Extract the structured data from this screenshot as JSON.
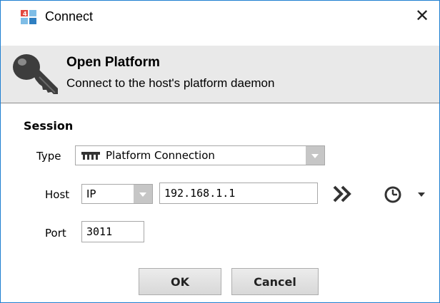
{
  "window": {
    "title": "Connect",
    "close_glyph": "✕"
  },
  "header": {
    "title": "Open Platform",
    "subtitle": "Connect to the host's platform daemon",
    "icon": "key-icon"
  },
  "session": {
    "section_label": "Session",
    "type": {
      "label": "Type",
      "value": "Platform Connection",
      "icon": "platform-connection-icon"
    },
    "host": {
      "label": "Host",
      "mode": "IP",
      "address": "192.168.1.1"
    },
    "port": {
      "label": "Port",
      "value": "3011"
    }
  },
  "actions": {
    "ok_label": "OK",
    "cancel_label": "Cancel"
  },
  "colors": {
    "window_border": "#1f7fd1",
    "banner_bg": "#e9e9e9",
    "dropdown_arrow_bg": "#c6c6c6"
  }
}
